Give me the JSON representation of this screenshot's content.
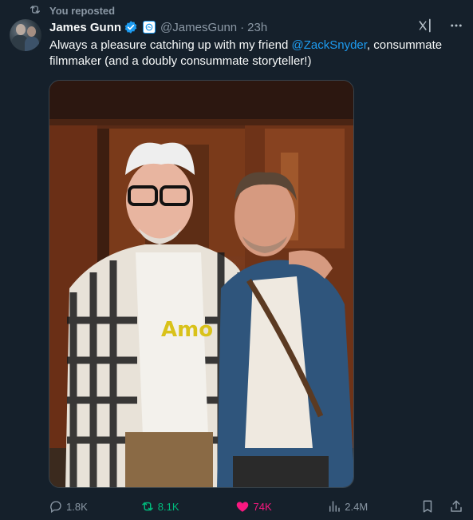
{
  "repost_banner": {
    "label": "You reposted",
    "icon": "repost-icon"
  },
  "author": {
    "name": "James Gunn",
    "verified": true,
    "handle": "@JamesGunn",
    "separator": "·",
    "time": "23h"
  },
  "tweet": {
    "text_before": "Always a pleasure catching up with my friend ",
    "mention": "@ZackSnyder",
    "text_after": ", consummate filmmaker (and a doubly consummate storyteller!)"
  },
  "metrics": {
    "replies": "1.8K",
    "reposts": "8.1K",
    "likes": "74K",
    "views": "2.4M"
  },
  "colors": {
    "background": "#15202b",
    "accent": "#1d9bf0",
    "repost_active": "#00ba7c",
    "like_active": "#f91880",
    "muted": "#8b98a5"
  }
}
